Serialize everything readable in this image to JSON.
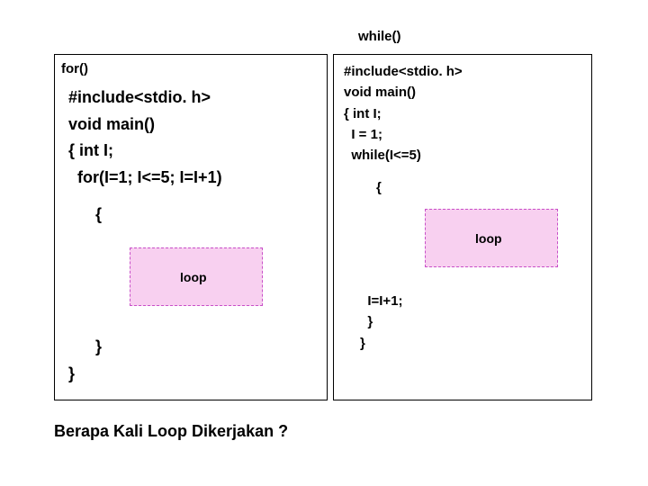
{
  "while_label": "while()",
  "for_label": "for()",
  "for_code": "#include<stdio. h>\nvoid main()\n{ int I;\n  for(I=1; I<=5; I=I+1)",
  "for_brace_open": "{",
  "for_brace_close1": "}",
  "for_brace_close2": "}",
  "while_code": "#include<stdio. h>\nvoid main()\n{ int I;\n  I = 1;\n  while(I<=5)",
  "while_brace_open": "{",
  "while_tail": "  I=I+1;\n  }\n}",
  "loop_label": "loop",
  "question": "Berapa Kali Loop Dikerjakan  ?"
}
